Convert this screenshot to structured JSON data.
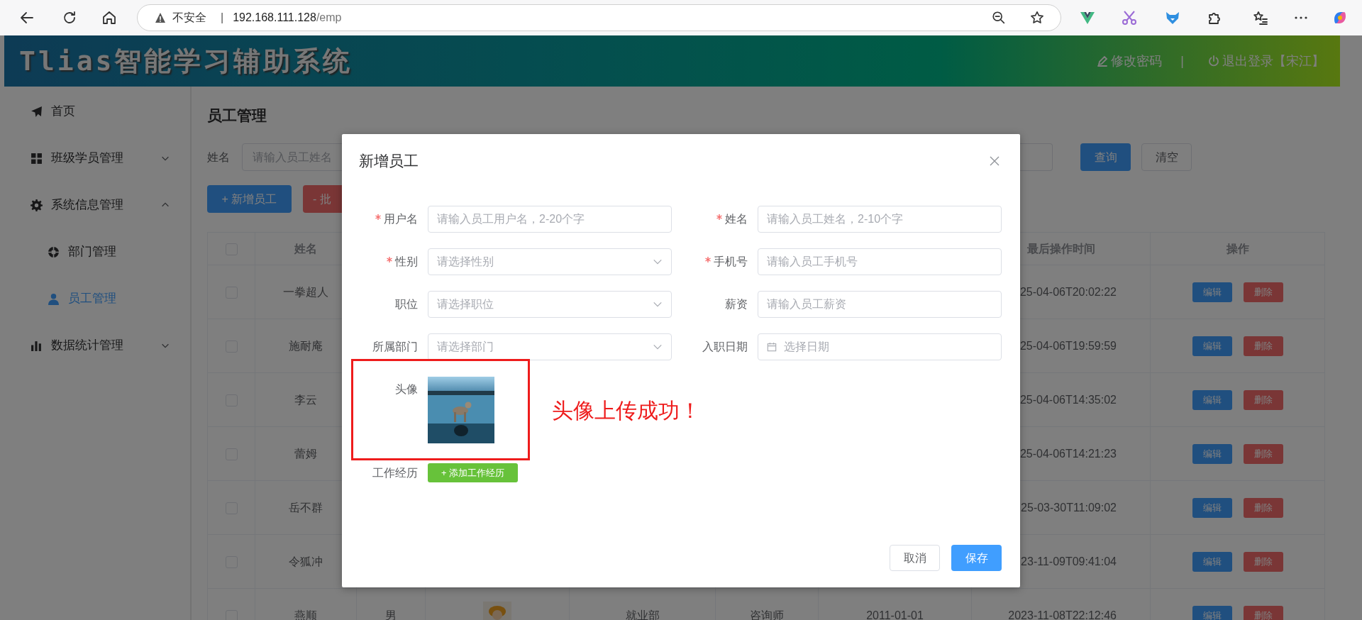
{
  "browser": {
    "security": "不安全",
    "separator": "|",
    "host": "192.168.111.128",
    "path": "/emp"
  },
  "header": {
    "title": "Tlias智能学习辅助系统",
    "separator": "|",
    "links": [
      {
        "kind": "edit",
        "label": "修改密码"
      },
      {
        "kind": "logout",
        "label": "退出登录【宋江】"
      }
    ]
  },
  "sidebar": {
    "items": [
      {
        "kind": "link",
        "label": "首页",
        "selected": false
      },
      {
        "kind": "group",
        "label": "班级学员管理",
        "selected": false,
        "expanded": false
      },
      {
        "kind": "group",
        "label": "系统信息管理",
        "selected": false,
        "expanded": true,
        "children": [
          {
            "label": "部门管理",
            "selected": false
          },
          {
            "label": "员工管理",
            "selected": true
          }
        ]
      },
      {
        "kind": "group",
        "label": "数据统计管理",
        "selected": false,
        "expanded": false
      }
    ]
  },
  "page_title": "员工管理",
  "search": {
    "label": "姓名",
    "placeholder": "请输入员工姓名",
    "buttons": [
      {
        "kind": "primary",
        "label": "查询"
      },
      {
        "kind": "plain",
        "label": "清空"
      }
    ]
  },
  "actions": [
    {
      "kind": "primary",
      "label": "+ 新增员工"
    },
    {
      "kind": "danger",
      "label": "- 批"
    }
  ],
  "table": {
    "header_checked": false,
    "columns": [
      {
        "label": "姓名"
      },
      {
        "label": "最后操作时间"
      },
      {
        "label": "操作"
      }
    ],
    "rows": [
      {
        "checked": false,
        "name": "一拳超人",
        "last_operated": "25-04-06T20:02:22",
        "actions": [
          {
            "kind": "edit",
            "label": "编辑"
          },
          {
            "kind": "delete",
            "label": "删除"
          }
        ]
      },
      {
        "checked": false,
        "name": "施耐庵",
        "last_operated": "25-04-06T19:59:59",
        "actions": [
          {
            "kind": "edit",
            "label": "编辑"
          },
          {
            "kind": "delete",
            "label": "删除"
          }
        ]
      },
      {
        "checked": false,
        "name": "李云",
        "last_operated": "25-04-06T14:35:02",
        "actions": [
          {
            "kind": "edit",
            "label": "编辑"
          },
          {
            "kind": "delete",
            "label": "删除"
          }
        ]
      },
      {
        "checked": false,
        "name": "蕾姆",
        "last_operated": "25-04-06T14:21:23",
        "actions": [
          {
            "kind": "edit",
            "label": "编辑"
          },
          {
            "kind": "delete",
            "label": "删除"
          }
        ]
      },
      {
        "checked": false,
        "name": "岳不群",
        "last_operated": "25-03-30T11:09:02",
        "actions": [
          {
            "kind": "edit",
            "label": "编辑"
          },
          {
            "kind": "delete",
            "label": "删除"
          }
        ]
      },
      {
        "checked": false,
        "name": "令狐冲",
        "last_operated": "23-11-09T09:41:04",
        "actions": [
          {
            "kind": "edit",
            "label": "编辑"
          },
          {
            "kind": "delete",
            "label": "删除"
          }
        ]
      },
      {
        "checked": false,
        "name": "燕顺",
        "column_3": "男",
        "column_4": {
          "kind": "picture"
        },
        "column_5": "就业部",
        "column_6": "咨询师",
        "column_7": "2011-01-01",
        "last_operated": "2023-11-08T22:12:46",
        "actions": [
          {
            "kind": "edit",
            "label": "编辑"
          },
          {
            "kind": "delete",
            "label": "删除"
          }
        ]
      }
    ]
  },
  "dialog": {
    "title": "新增员工",
    "fields": [
      {
        "label": "用户名",
        "required": true,
        "kind": "input",
        "placeholder": "请输入员工用户名，2-20个字"
      },
      {
        "label": "姓名",
        "required": true,
        "kind": "input",
        "placeholder": "请输入员工姓名，2-10个字"
      },
      {
        "label": "性别",
        "required": true,
        "kind": "select",
        "placeholder": "请选择性别"
      },
      {
        "label": "手机号",
        "required": true,
        "kind": "input",
        "placeholder": "请输入员工手机号"
      },
      {
        "label": "职位",
        "required": false,
        "kind": "select",
        "placeholder": "请选择职位"
      },
      {
        "label": "薪资",
        "required": false,
        "kind": "input",
        "placeholder": "请输入员工薪资"
      },
      {
        "label": "所属部门",
        "required": false,
        "kind": "select",
        "placeholder": "请选择部门"
      },
      {
        "label": "入职日期",
        "required": false,
        "kind": "date",
        "placeholder": "选择日期"
      }
    ],
    "avatar": {
      "label": "头像",
      "image": {
        "kind": "picture"
      },
      "annotation": "头像上传成功！"
    },
    "experience": {
      "label": "工作经历",
      "button": "+ 添加工作经历"
    },
    "buttons": [
      {
        "kind": "plain",
        "label": "取消"
      },
      {
        "kind": "primary",
        "label": "保存"
      }
    ]
  }
}
